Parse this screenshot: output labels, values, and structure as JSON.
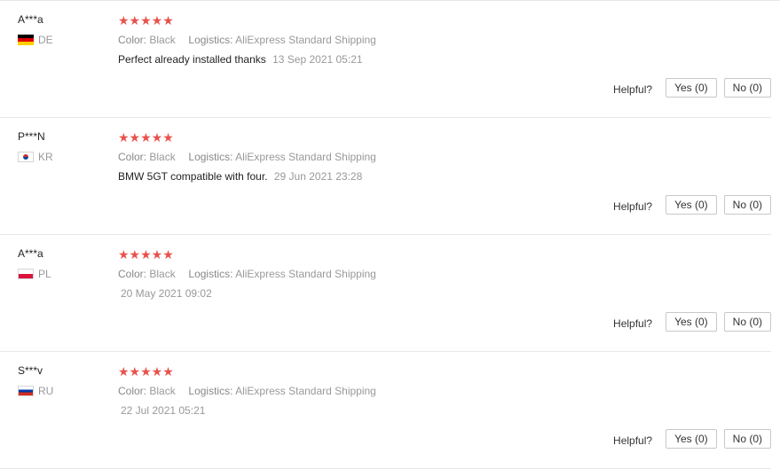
{
  "labels": {
    "color": "Color:",
    "logistics": "Logistics:",
    "helpful": "Helpful?",
    "yes": "Yes (0)",
    "no": "No (0)"
  },
  "colors": {
    "star": "#e8524c"
  },
  "reviews": [
    {
      "user": "A***a",
      "country": "DE",
      "flag_icon": "de-flag-icon",
      "stars": "★★★★★",
      "rating": 5,
      "color": "Black",
      "logistics": "AliExpress Standard Shipping",
      "text": "Perfect already installed thanks",
      "date": "13 Sep 2021 05:21"
    },
    {
      "user": "P***N",
      "country": "KR",
      "flag_icon": "kr-flag-icon",
      "stars": "★★★★★",
      "rating": 4.5,
      "color": "Black",
      "logistics": "AliExpress Standard Shipping",
      "text": "BMW 5GT compatible with four.",
      "date": "29 Jun 2021 23:28"
    },
    {
      "user": "A***a",
      "country": "PL",
      "flag_icon": "pl-flag-icon",
      "stars": "★★★★★",
      "rating": 4.5,
      "color": "Black",
      "logistics": "AliExpress Standard Shipping",
      "text": "",
      "date": "20 May 2021 09:02"
    },
    {
      "user": "S***v",
      "country": "RU",
      "flag_icon": "ru-flag-icon",
      "stars": "★★★★★",
      "rating": 5,
      "color": "Black",
      "logistics": "AliExpress Standard Shipping",
      "text": "",
      "date": "22 Jul 2021 05:21"
    }
  ]
}
